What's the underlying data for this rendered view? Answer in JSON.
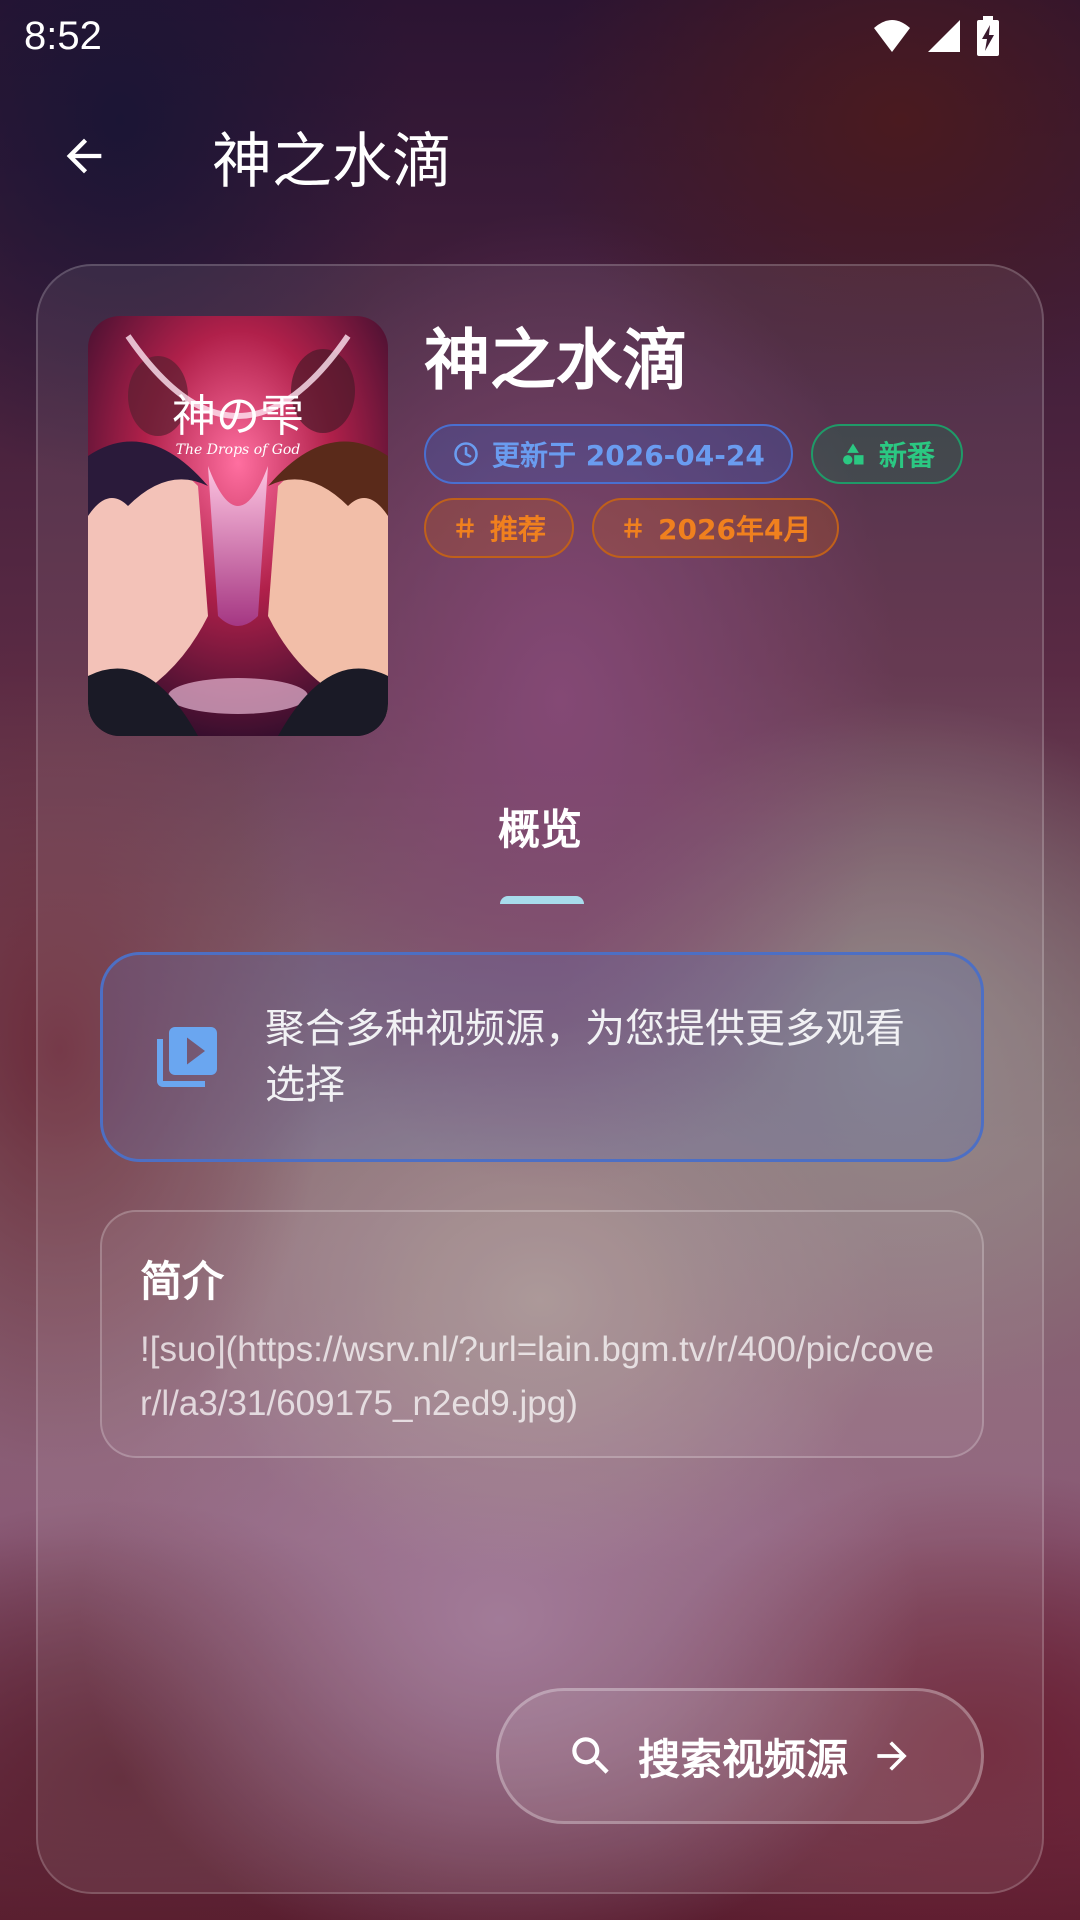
{
  "status_bar": {
    "time": "8:52",
    "icons": [
      "wifi-icon",
      "signal-icon",
      "battery-charging-icon"
    ]
  },
  "app_bar": {
    "back_icon": "arrow-left-icon",
    "title": "神之水滴"
  },
  "detail": {
    "title": "神之水滴",
    "chips": [
      {
        "icon": "clock-icon",
        "label": "更新于 2026-04-24",
        "color": "#6a9cf0"
      },
      {
        "icon": "shapes-icon",
        "label": "新番",
        "color": "#2bc882"
      },
      {
        "icon": "hash-icon",
        "label": "推荐",
        "color": "#f0801e"
      },
      {
        "icon": "hash-icon",
        "label": "2026年4月",
        "color": "#f0801e"
      }
    ],
    "poster": {
      "title_text": "神の雫",
      "subtitle_text": "The Drops of God"
    }
  },
  "tabs": [
    {
      "label": "概览",
      "active": true
    }
  ],
  "notice": {
    "icon": "video-library-icon",
    "text": "聚合多种视频源，为您提供更多观看选择"
  },
  "summary": {
    "title": "简介",
    "body": "![suo](https://wsrv.nl/?url=lain.bgm.tv/r/400/pic/cover/l/a3/31/609175_n2ed9.jpg)"
  },
  "search_button": {
    "icon": "search-icon",
    "label": "搜索视频源",
    "trailing_icon": "arrow-right-icon"
  },
  "colors": {
    "accent_blue": "#4a6fd0",
    "accent_green": "#1f9a68",
    "accent_orange": "#c0601a",
    "tab_indicator": "#a8dcec"
  }
}
